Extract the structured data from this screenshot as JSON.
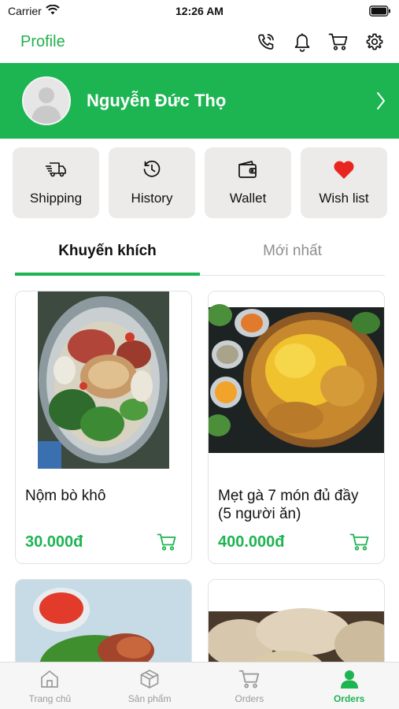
{
  "status_bar": {
    "carrier": "Carrier",
    "time": "12:26 AM"
  },
  "header": {
    "title": "Profile",
    "icons": [
      "phone-call-icon",
      "bell-icon",
      "cart-icon",
      "gear-icon"
    ]
  },
  "profile": {
    "name": "Nguyễn Đức Thọ"
  },
  "quick_actions": [
    {
      "label": "Shipping",
      "icon": "truck-icon"
    },
    {
      "label": "History",
      "icon": "clock-history-icon"
    },
    {
      "label": "Wallet",
      "icon": "wallet-icon"
    },
    {
      "label": "Wish list",
      "icon": "heart-icon"
    }
  ],
  "tabs": [
    {
      "label": "Khuyến khích",
      "active": true
    },
    {
      "label": "Mới nhất",
      "active": false
    }
  ],
  "products": [
    {
      "name": "Nộm bò khô",
      "price": "30.000đ"
    },
    {
      "name": "Mẹt gà 7 món đủ đầy (5 người ăn)",
      "price": "400.000đ"
    }
  ],
  "bottom_nav": [
    {
      "label": "Trang chủ",
      "icon": "home-icon",
      "active": false
    },
    {
      "label": "Sản phẩm",
      "icon": "box-icon",
      "active": false
    },
    {
      "label": "Orders",
      "icon": "cart-icon",
      "active": false
    },
    {
      "label": "Orders",
      "icon": "person-icon",
      "active": true
    }
  ],
  "colors": {
    "accent": "#1db452",
    "tile_bg": "#ecebea",
    "price": "#1db452"
  }
}
